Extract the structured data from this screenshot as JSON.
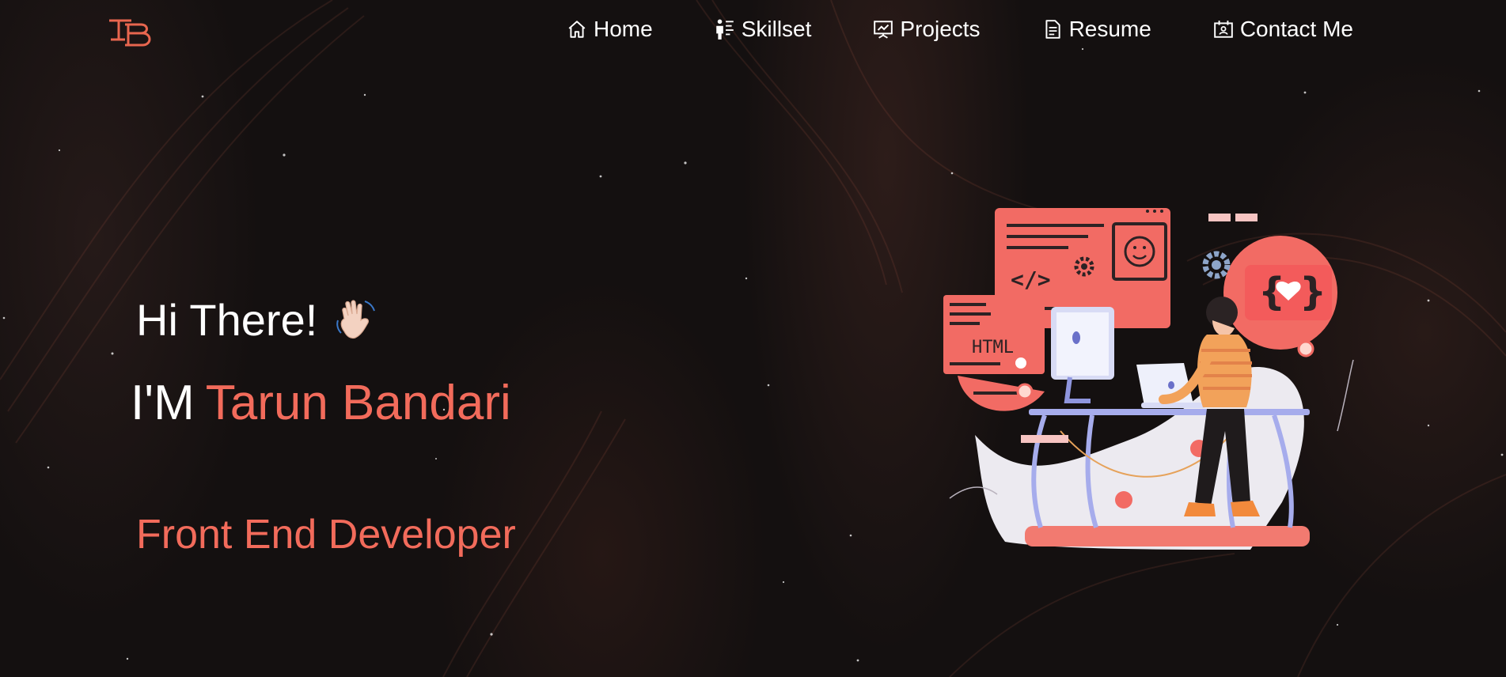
{
  "logo": {
    "text": "TB",
    "icon": "tb-logo"
  },
  "nav": {
    "items": [
      {
        "label": "Home",
        "icon": "home-icon"
      },
      {
        "label": "Skillset",
        "icon": "skillset-icon"
      },
      {
        "label": "Projects",
        "icon": "projects-icon"
      },
      {
        "label": "Resume",
        "icon": "resume-icon"
      },
      {
        "label": "Contact Me",
        "icon": "contact-icon"
      }
    ]
  },
  "hero": {
    "greeting": "Hi There!",
    "greeting_emoji": "waving-hand-icon",
    "intro_prefix": "I'M",
    "name": "Tarun Bandari",
    "role": "Front End Developer"
  },
  "illustration": {
    "html_tag": "HTML",
    "code_symbol": "</>"
  },
  "colors": {
    "accent": "#f26b5b",
    "background": "#141010",
    "text": "#ffffff"
  }
}
